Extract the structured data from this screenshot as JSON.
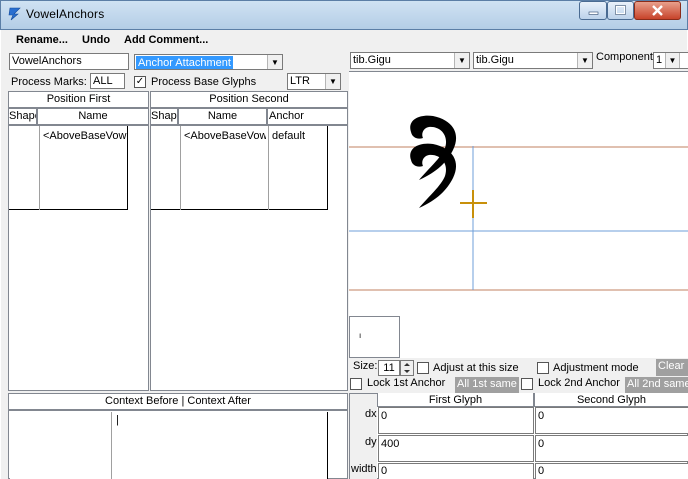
{
  "window": {
    "title": "VowelAnchors"
  },
  "menu": {
    "rename": "Rename...",
    "undo": "Undo",
    "add_comment": "Add Comment..."
  },
  "top": {
    "name_field": "VowelAnchors",
    "type_select": "Anchor Attachment",
    "process_marks_label": "Process Marks:",
    "process_marks_value": "ALL",
    "process_base_label": "Process Base Glyphs",
    "direction": "LTR"
  },
  "position_first": {
    "header": "Position First",
    "columns": [
      "Shape",
      "Name"
    ],
    "rows": [
      {
        "shape_glyph": "ุ",
        "name": "<AboveBaseVow"
      }
    ]
  },
  "position_second": {
    "header": "Position Second",
    "columns": [
      "Shape",
      "Name",
      "Anchor"
    ],
    "rows": [
      {
        "shape_glyph": "ุ",
        "name": "<AboveBaseVow",
        "anchor": "default"
      }
    ]
  },
  "context": {
    "header": "Context Before | Context After",
    "after_value": "|"
  },
  "preview": {
    "font1": "tib.Gigu",
    "font2": "tib.Gigu",
    "component_label": "Component:",
    "component_value": "1",
    "thumb_mark": "ı",
    "size_label": "Size:",
    "size_value": "11",
    "adjust_label": "Adjust at this size",
    "adjustment_mode_label": "Adjustment mode",
    "clear_label": "Clear",
    "lock1_label": "Lock 1st Anchor",
    "all1_label": "All 1st same",
    "lock2_label": "Lock 2nd Anchor",
    "all2_label": "All 2nd same",
    "colors": {
      "baseline": "#c08060",
      "guide": "#6f9fd8",
      "anchor": "#c8900a"
    }
  },
  "glyph_table": {
    "col1": "First Glyph",
    "col2": "Second Glyph",
    "rows": [
      {
        "label": "dx",
        "first": "0",
        "second": "0"
      },
      {
        "label": "dy",
        "first": "400",
        "second": "0"
      },
      {
        "label": "width",
        "first": "0",
        "second": "0"
      }
    ]
  }
}
